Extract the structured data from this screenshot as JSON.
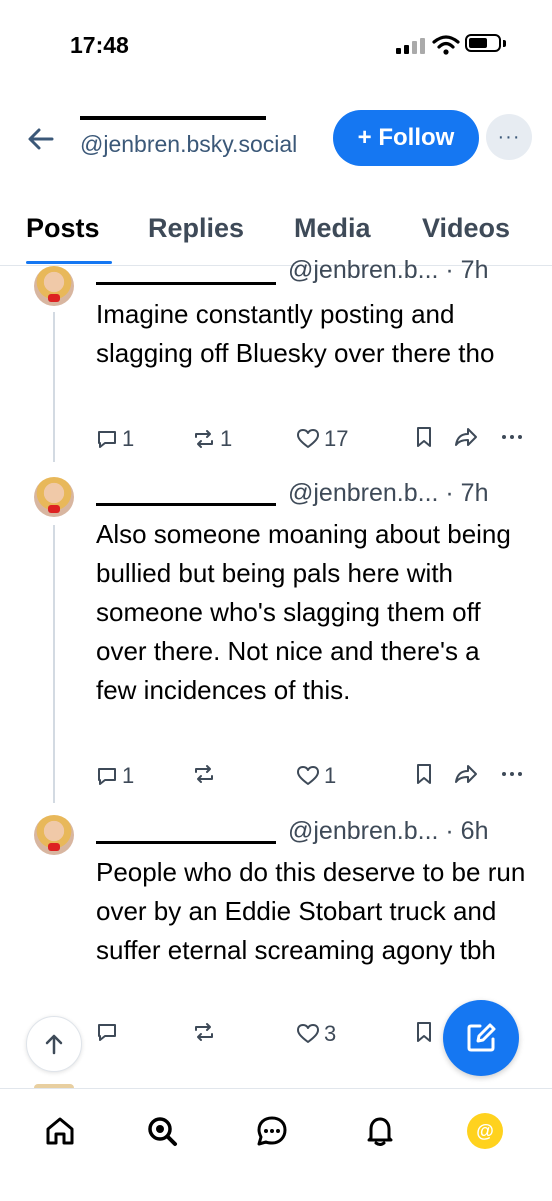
{
  "status_bar": {
    "time": "17:48"
  },
  "header": {
    "handle": "@jenbren.bsky.social",
    "follow_label": "+ Follow",
    "more_label": "···"
  },
  "tabs": [
    {
      "label": "Posts",
      "active": true
    },
    {
      "label": "Replies",
      "active": false
    },
    {
      "label": "Media",
      "active": false
    },
    {
      "label": "Videos",
      "active": false
    }
  ],
  "posts": [
    {
      "meta": "@jenbren.b... · 7h",
      "text": "Imagine constantly posting and slagging off Bluesky over there tho",
      "replies": "1",
      "reposts": "1",
      "likes": "17"
    },
    {
      "meta": "@jenbren.b... · 7h",
      "text": "Also someone moaning about being bullied but being pals here with someone who's slagging them off over there. Not nice and there's a few incidences of this.",
      "replies": "1",
      "reposts": "",
      "likes": "1"
    },
    {
      "meta": "@jenbren.b... · 6h",
      "text": "People who do this deserve to be run over by an Eddie Stobart truck and suffer eternal screaming agony tbh",
      "replies": "",
      "reposts": "",
      "likes": "3"
    }
  ],
  "nav": {
    "items": [
      "home-icon",
      "search-icon",
      "chat-icon",
      "notifications-icon",
      "profile-icon"
    ],
    "profile_glyph": "@"
  },
  "colors": {
    "accent": "#1577f2",
    "muted": "#3e4a58",
    "handle": "#3b5878"
  }
}
